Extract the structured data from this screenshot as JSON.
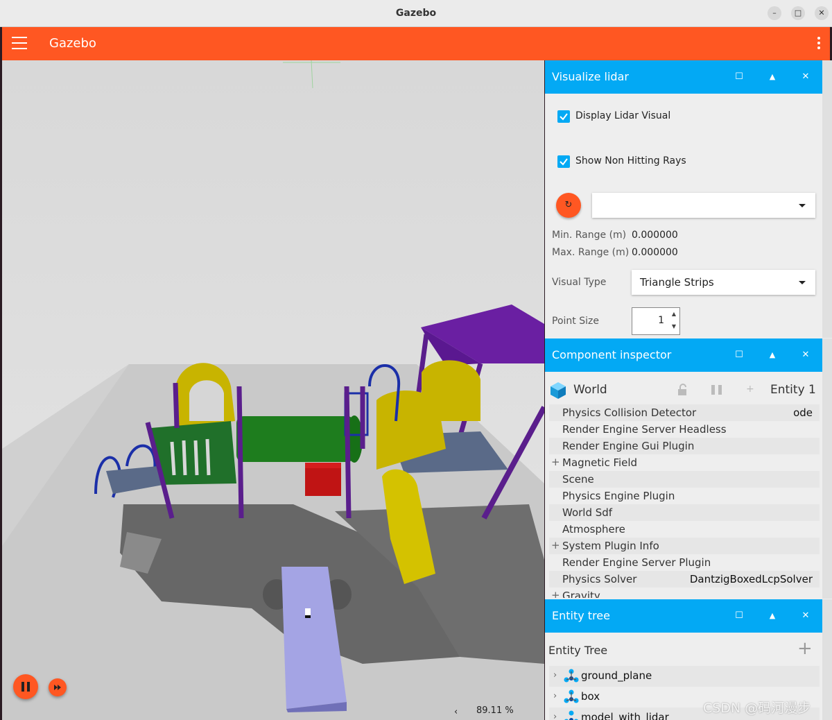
{
  "window": {
    "title": "Gazebo",
    "minimize": "–",
    "maximize": "□",
    "close": "✕"
  },
  "appbar": {
    "title": "Gazebo",
    "menu_icon": "hamburger-icon",
    "more_icon": "kebab-icon",
    "color": "#ff5722"
  },
  "scene": {
    "zoom": "89.11 %",
    "zoom_toggle": "‹",
    "play_icon": "pause-icon",
    "step_icon": "fast-forward-icon"
  },
  "lidar_panel": {
    "title": "Visualize lidar",
    "display_visual": {
      "label": "Display Lidar Visual",
      "checked": true
    },
    "non_hitting": {
      "label": "Show Non Hitting Rays",
      "checked": true
    },
    "refresh_icon": "↻",
    "topic_value": "",
    "min_range": {
      "label": "Min. Range (m)",
      "value": "0.000000"
    },
    "max_range": {
      "label": "Max. Range (m)",
      "value": "0.000000"
    },
    "visual_type": {
      "label": "Visual Type",
      "value": "Triangle Strips"
    },
    "point_size": {
      "label": "Point Size",
      "value": "1"
    }
  },
  "component_inspector": {
    "title": "Component inspector",
    "header": {
      "name": "World",
      "entity": "Entity 1"
    },
    "rows": [
      {
        "name": "Physics Collision Detector",
        "value": "ode",
        "expandable": false
      },
      {
        "name": "Render Engine Server Headless",
        "value": "",
        "expandable": false
      },
      {
        "name": "Render Engine Gui Plugin",
        "value": "",
        "expandable": false
      },
      {
        "name": "Magnetic Field",
        "value": "",
        "expandable": true
      },
      {
        "name": "Scene",
        "value": "",
        "expandable": false
      },
      {
        "name": "Physics Engine Plugin",
        "value": "",
        "expandable": false
      },
      {
        "name": "World Sdf",
        "value": "",
        "expandable": false
      },
      {
        "name": "Atmosphere",
        "value": "",
        "expandable": false
      },
      {
        "name": "System Plugin Info",
        "value": "",
        "expandable": true
      },
      {
        "name": "Render Engine Server Plugin",
        "value": "",
        "expandable": false
      },
      {
        "name": "Physics Solver",
        "value": "DantzigBoxedLcpSolver",
        "expandable": false
      },
      {
        "name": "Gravity",
        "value": "",
        "expandable": true
      }
    ]
  },
  "entity_tree": {
    "title": "Entity tree",
    "header": "Entity Tree",
    "add_label": "+",
    "items": [
      "ground_plane",
      "box",
      "model_with_lidar"
    ]
  },
  "panel_buttons": {
    "maximize": "☐",
    "collapse": "▲",
    "close": "✕"
  },
  "colors": {
    "panel_header": "#03a9f4",
    "accent": "#ff5722"
  },
  "watermark": "CSDN @码河漫步"
}
